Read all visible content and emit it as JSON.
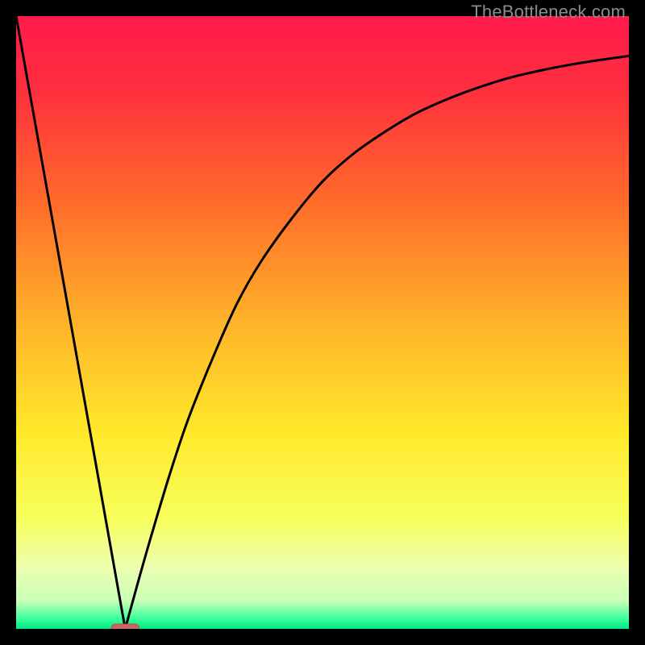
{
  "watermark": "TheBottleneck.com",
  "colors": {
    "frame": "#000000",
    "curve": "#000000",
    "marker_fill": "#c96762",
    "marker_stroke": "#b84f4a",
    "gradient_stops": [
      {
        "offset": 0.0,
        "color": "#ff1a4b"
      },
      {
        "offset": 0.12,
        "color": "#ff2f3f"
      },
      {
        "offset": 0.3,
        "color": "#ff6a2a"
      },
      {
        "offset": 0.5,
        "color": "#ffb32a"
      },
      {
        "offset": 0.68,
        "color": "#ffe92a"
      },
      {
        "offset": 0.82,
        "color": "#f7ff5c"
      },
      {
        "offset": 0.9,
        "color": "#ecffb0"
      },
      {
        "offset": 0.955,
        "color": "#c8ffb8"
      },
      {
        "offset": 0.985,
        "color": "#33ff99"
      },
      {
        "offset": 1.0,
        "color": "#00e885"
      }
    ]
  },
  "chart_data": {
    "type": "line",
    "title": "",
    "xlabel": "",
    "ylabel": "",
    "xlim": [
      0,
      100
    ],
    "ylim": [
      0,
      100
    ],
    "note": "Bottleneck-style chart: y is a penalty metric that drops to 0 at the optimal x and rises on either side. Background is a vertical green→red gradient indicating severity.",
    "series": [
      {
        "name": "left-branch",
        "x": [
          0,
          17.8
        ],
        "y": [
          100,
          0
        ]
      },
      {
        "name": "right-branch",
        "x": [
          17.8,
          20,
          22,
          25,
          28,
          32,
          36,
          40,
          45,
          50,
          55,
          60,
          65,
          70,
          75,
          80,
          85,
          90,
          95,
          100
        ],
        "y": [
          0,
          8,
          15,
          25,
          34,
          44,
          53,
          60,
          67,
          73,
          77.5,
          81,
          84,
          86.3,
          88.2,
          89.8,
          91,
          92,
          92.8,
          93.5
        ]
      }
    ],
    "minimum_marker": {
      "x": 17.8,
      "y": 0,
      "width": 4.5
    }
  }
}
